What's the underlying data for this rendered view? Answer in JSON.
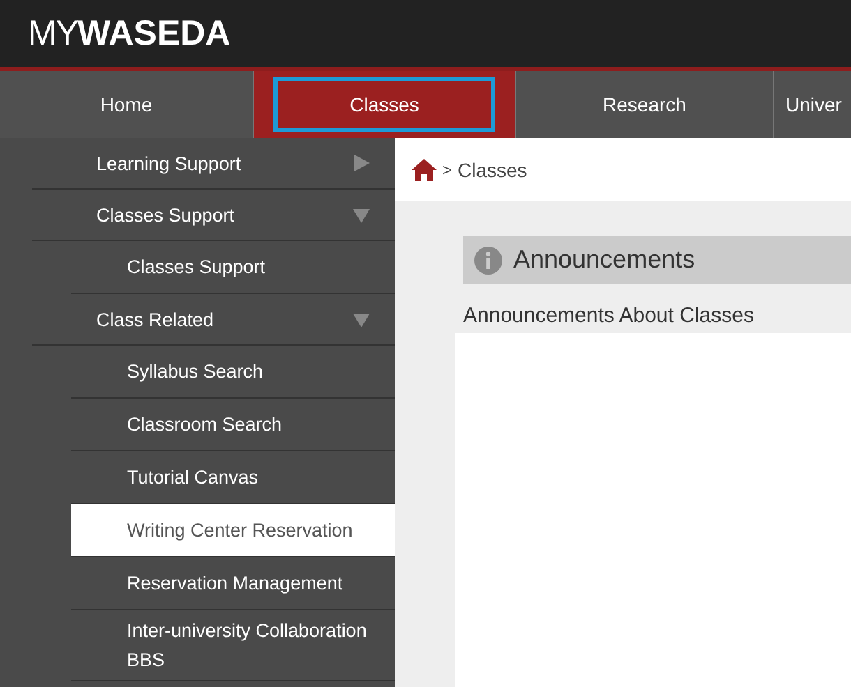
{
  "header": {
    "logo_light": "MY",
    "logo_bold": "WASEDA"
  },
  "nav_tabs": [
    {
      "label": "Home",
      "selected": false
    },
    {
      "label": "Classes",
      "selected": true
    },
    {
      "label": "Research",
      "selected": false
    },
    {
      "label": "Univer",
      "selected": false
    }
  ],
  "sidebar": {
    "items": [
      {
        "label": "Learning Support",
        "expanded": false
      },
      {
        "label": "Classes Support",
        "expanded": true,
        "children": [
          {
            "label": "Classes Support",
            "selected": false
          }
        ]
      },
      {
        "label": "Class Related",
        "expanded": true,
        "children": [
          {
            "label": "Syllabus Search",
            "selected": false
          },
          {
            "label": "Classroom Search",
            "selected": false
          },
          {
            "label": "Tutorial Canvas",
            "selected": false
          },
          {
            "label": "Writing Center Reservation",
            "selected": true
          },
          {
            "label": "Reservation Management",
            "selected": false
          },
          {
            "label": "Inter-university Collaboration BBS",
            "selected": false
          }
        ]
      }
    ]
  },
  "breadcrumb": {
    "separator": ">",
    "current": "Classes"
  },
  "announcements": {
    "title": "Announcements",
    "subtitle": "Announcements About Classes"
  }
}
